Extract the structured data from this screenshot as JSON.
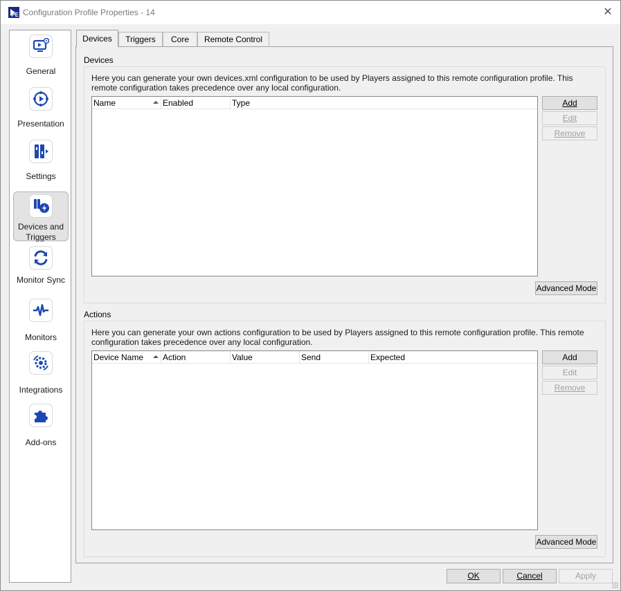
{
  "window": {
    "title": "Configuration Profile Properties - 14",
    "app_icon_text": "PE"
  },
  "nav": {
    "items": [
      {
        "label": "General",
        "icon": "monitor-settings-icon"
      },
      {
        "label": "Presentation",
        "icon": "presentation-play-icon"
      },
      {
        "label": "Settings",
        "icon": "settings-sliders-icon"
      },
      {
        "label": "Devices and Triggers",
        "icon": "devices-triggers-icon",
        "active": true
      },
      {
        "label": "Monitor Sync",
        "icon": "monitor-sync-icon"
      },
      {
        "label": "Monitors",
        "icon": "heartbeat-icon"
      },
      {
        "label": "Integrations",
        "icon": "integrations-gear-icon"
      },
      {
        "label": "Add-ons",
        "icon": "puzzle-piece-icon"
      }
    ],
    "accent_color": "#1d47b3"
  },
  "tabs": [
    {
      "label": "Devices",
      "active": true
    },
    {
      "label": "Triggers"
    },
    {
      "label": "Core"
    },
    {
      "label": "Remote Control"
    }
  ],
  "devices_section": {
    "title": "Devices",
    "description": "Here you can generate your own devices.xml configuration to be used by Players assigned to this remote configuration profile. This remote configuration takes precedence over any local configuration.",
    "columns": [
      "Name",
      "Enabled",
      "Type"
    ],
    "rows": [],
    "buttons": {
      "add": "Add",
      "edit": "Edit",
      "remove": "Remove",
      "advanced": "Advanced Mode"
    }
  },
  "actions_section": {
    "title": "Actions",
    "description": "Here you can generate your own actions configuration to be used by Players assigned to this remote configuration profile. This remote configuration takes precedence over any local configuration.",
    "columns": [
      "Device Name",
      "Action",
      "Value",
      "Send",
      "Expected"
    ],
    "rows": [],
    "buttons": {
      "add": "Add",
      "edit": "Edit",
      "remove": "Remove",
      "advanced": "Advanced Mode"
    }
  },
  "footer": {
    "ok": "OK",
    "cancel": "Cancel",
    "apply": "Apply"
  }
}
